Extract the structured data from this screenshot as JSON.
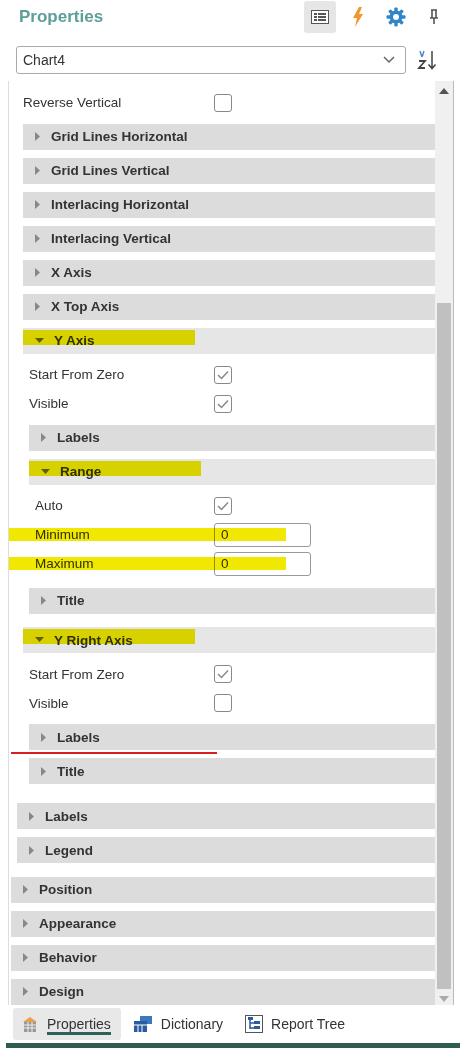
{
  "header": {
    "title": "Properties",
    "tool_icons": [
      {
        "kind": "grid",
        "selected": true
      },
      {
        "kind": "events",
        "selected": false
      },
      {
        "kind": "settings",
        "selected": false
      },
      {
        "kind": "pin",
        "selected": false
      }
    ]
  },
  "component_select": {
    "value": "Chart4"
  },
  "series_properties": [
    {
      "kind": "checkbox",
      "label": "Reverse Vertical",
      "checked": false,
      "highlighted": false
    },
    {
      "kind": "group",
      "label": "Grid Lines Horizontal",
      "expanded": false,
      "highlighted": false
    },
    {
      "kind": "group",
      "label": "Grid Lines Vertical",
      "expanded": false,
      "highlighted": false
    },
    {
      "kind": "group",
      "label": "Interlacing Horizontal",
      "expanded": false,
      "highlighted": false
    },
    {
      "kind": "group",
      "label": "Interlacing Vertical",
      "expanded": false,
      "highlighted": false
    },
    {
      "kind": "group",
      "label": "X Axis",
      "expanded": false,
      "highlighted": false
    },
    {
      "kind": "group",
      "label": "X Top Axis",
      "expanded": false,
      "highlighted": false
    },
    {
      "kind": "group",
      "label": "Y Axis",
      "expanded": true,
      "highlighted": true,
      "children": [
        {
          "kind": "checkbox",
          "label": "Start From Zero",
          "checked": true,
          "highlighted": false
        },
        {
          "kind": "checkbox",
          "label": "Visible",
          "checked": true,
          "highlighted": false
        },
        {
          "kind": "group",
          "label": "Labels",
          "expanded": false,
          "highlighted": false
        },
        {
          "kind": "group",
          "label": "Range",
          "expanded": true,
          "highlighted": true,
          "children": [
            {
              "kind": "checkbox",
              "label": "Auto",
              "checked": true,
              "highlighted": false
            },
            {
              "kind": "field",
              "label": "Minimum",
              "value": "0",
              "highlighted": true
            },
            {
              "kind": "field",
              "label": "Maximum",
              "value": "0",
              "highlighted": true
            }
          ]
        },
        {
          "kind": "group",
          "label": "Title",
          "expanded": false,
          "highlighted": false
        }
      ]
    },
    {
      "kind": "group",
      "label": "Y Right Axis",
      "expanded": true,
      "highlighted": true,
      "children": [
        {
          "kind": "checkbox",
          "label": "Start From Zero",
          "checked": true,
          "underlined": false
        },
        {
          "kind": "checkbox",
          "label": "Visible",
          "checked": false,
          "underlined": false
        },
        {
          "kind": "group",
          "label": "Labels",
          "expanded": false,
          "underlined": true
        },
        {
          "kind": "group",
          "label": "Title",
          "expanded": false,
          "underlined": false
        }
      ]
    }
  ],
  "chart_groups": [
    {
      "kind": "group",
      "label": "Labels",
      "expanded": false
    },
    {
      "kind": "group",
      "label": "Legend",
      "expanded": false
    }
  ],
  "categories": [
    {
      "kind": "group",
      "label": "Position",
      "expanded": false
    },
    {
      "kind": "group",
      "label": "Appearance",
      "expanded": false
    },
    {
      "kind": "group",
      "label": "Behavior",
      "expanded": false
    },
    {
      "kind": "group",
      "label": "Design",
      "expanded": false
    }
  ],
  "bottom_tabs": [
    {
      "label": "Properties",
      "kind": "properties",
      "selected": true
    },
    {
      "label": "Dictionary",
      "kind": "dictionary",
      "selected": false
    },
    {
      "label": "Report Tree",
      "kind": "tree",
      "selected": false
    }
  ]
}
